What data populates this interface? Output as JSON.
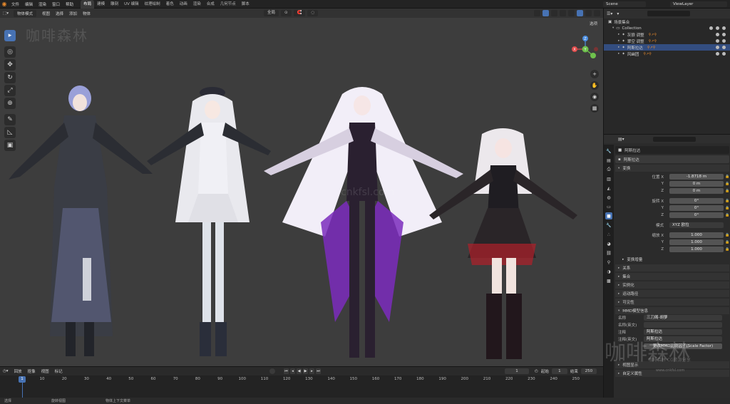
{
  "app": {
    "menu": [
      "文件",
      "编辑",
      "渲染",
      "窗口",
      "帮助"
    ],
    "workspaces": [
      "布局",
      "建模",
      "雕刻",
      "UV 编辑",
      "纹理绘制",
      "着色",
      "动画",
      "渲染",
      "合成",
      "几何节点",
      "脚本"
    ],
    "active_workspace": "布局",
    "scene": "Scene",
    "view_layer": "ViewLayer"
  },
  "viewport": {
    "mode": "物体模式",
    "menus": [
      "视图",
      "选择",
      "添加",
      "物体"
    ],
    "orientation": "全局",
    "options_label": "选项",
    "watermark_tl": "咖啡森林",
    "watermark_mid": "cnkfsl.com",
    "tools": [
      {
        "name": "select-box-icon",
        "glyph": "▸"
      },
      {
        "name": "cursor-icon",
        "glyph": "◎"
      },
      {
        "name": "move-icon",
        "glyph": "✥"
      },
      {
        "name": "rotate-icon",
        "glyph": "↻"
      },
      {
        "name": "scale-icon",
        "glyph": "⤢"
      },
      {
        "name": "transform-icon",
        "glyph": "⊕"
      },
      {
        "name": "annotate-icon",
        "glyph": "✎"
      },
      {
        "name": "measure-icon",
        "glyph": "◺"
      },
      {
        "name": "add-cube-icon",
        "glyph": "▣"
      }
    ],
    "nav_buttons": [
      {
        "name": "zoom-icon",
        "glyph": "+"
      },
      {
        "name": "pan-hand-icon",
        "glyph": "✋"
      },
      {
        "name": "camera-icon",
        "glyph": "◉"
      },
      {
        "name": "grid-icon",
        "glyph": "▦"
      }
    ],
    "gizmo": {
      "x": "X",
      "y": "Y",
      "z": "Z"
    }
  },
  "outliner": {
    "root": "场景集合",
    "collection": "Collection",
    "items": [
      {
        "label": "灰狼 调整",
        "selected": false
      },
      {
        "label": "翠空 调整",
        "selected": false
      },
      {
        "label": "阿斯拉达",
        "selected": true
      },
      {
        "label": "风幽团",
        "selected": false
      }
    ]
  },
  "properties": {
    "object_name": "阿斯拉达",
    "data_name": "阿斯拉达",
    "transform_header": "变换",
    "location_label": "位置 X",
    "location": [
      "-1.8718 m",
      "0 m",
      "0 m"
    ],
    "rotation_label": "旋转 X",
    "rotation": [
      "0°",
      "0°",
      "0°"
    ],
    "mode_label": "模式",
    "mode_value": "XYZ 欧拉",
    "scale_label": "缩放 X",
    "scale": [
      "1.000",
      "1.000",
      "1.000"
    ],
    "axis_y": "Y",
    "axis_z": "Z",
    "delta": "变换增量",
    "panels": [
      "关系",
      "集合",
      "实例化",
      "运动路径",
      "可见性"
    ],
    "mmd_header": "MMD模型信息",
    "mmd_name_label": "名称",
    "mmd_name": "三刀阁-胡萝",
    "mmd_name_en_label": "名称(英文)",
    "mmd_comment_label": "注释",
    "mmd_comment": "阿斯拉达",
    "mmd_comment_en_label": "注释(英文)",
    "mmd_comment_en": "阿斯拉达",
    "mmd_btn": "更改MMD比例因子(Scale Factor)",
    "bottom_panels": [
      "视图显示",
      "自定义属性"
    ],
    "watermark": "咖啡森林",
    "watermark_small": "咖啡森林 CG资源分享",
    "watermark_url": "www.cnkfsl.com",
    "tabs": [
      {
        "name": "tool-tab-icon",
        "glyph": "🔧"
      },
      {
        "name": "render-tab-icon",
        "glyph": "▤"
      },
      {
        "name": "output-tab-icon",
        "glyph": "⎙"
      },
      {
        "name": "view-layer-tab-icon",
        "glyph": "▥"
      },
      {
        "name": "scene-tab-icon",
        "glyph": "◭"
      },
      {
        "name": "world-tab-icon",
        "glyph": "◍"
      },
      {
        "name": "collection-tab-icon",
        "glyph": "▭"
      },
      {
        "name": "object-tab-icon",
        "glyph": "■"
      },
      {
        "name": "modifier-tab-icon",
        "glyph": "🔧"
      },
      {
        "name": "particles-tab-icon",
        "glyph": "∴"
      },
      {
        "name": "physics-tab-icon",
        "glyph": "◕"
      },
      {
        "name": "constraints-tab-icon",
        "glyph": "⛓"
      },
      {
        "name": "data-tab-icon",
        "glyph": "⚲"
      },
      {
        "name": "material-tab-icon",
        "glyph": "◑"
      },
      {
        "name": "texture-tab-icon",
        "glyph": "▩"
      }
    ]
  },
  "timeline": {
    "menus": [
      "回放",
      "抠像",
      "视图",
      "标记"
    ],
    "current_frame": "1",
    "start_label": "起始",
    "start": "1",
    "end_label": "结束",
    "end": "250",
    "ticks": [
      "10",
      "20",
      "30",
      "40",
      "50",
      "60",
      "70",
      "80",
      "90",
      "100",
      "110",
      "120",
      "130",
      "140",
      "150",
      "160",
      "170",
      "180",
      "190",
      "200",
      "210",
      "220",
      "230",
      "240",
      "250"
    ],
    "cursor": "1"
  },
  "status": [
    "选择",
    "旋转视图",
    "物体上下文菜单"
  ]
}
